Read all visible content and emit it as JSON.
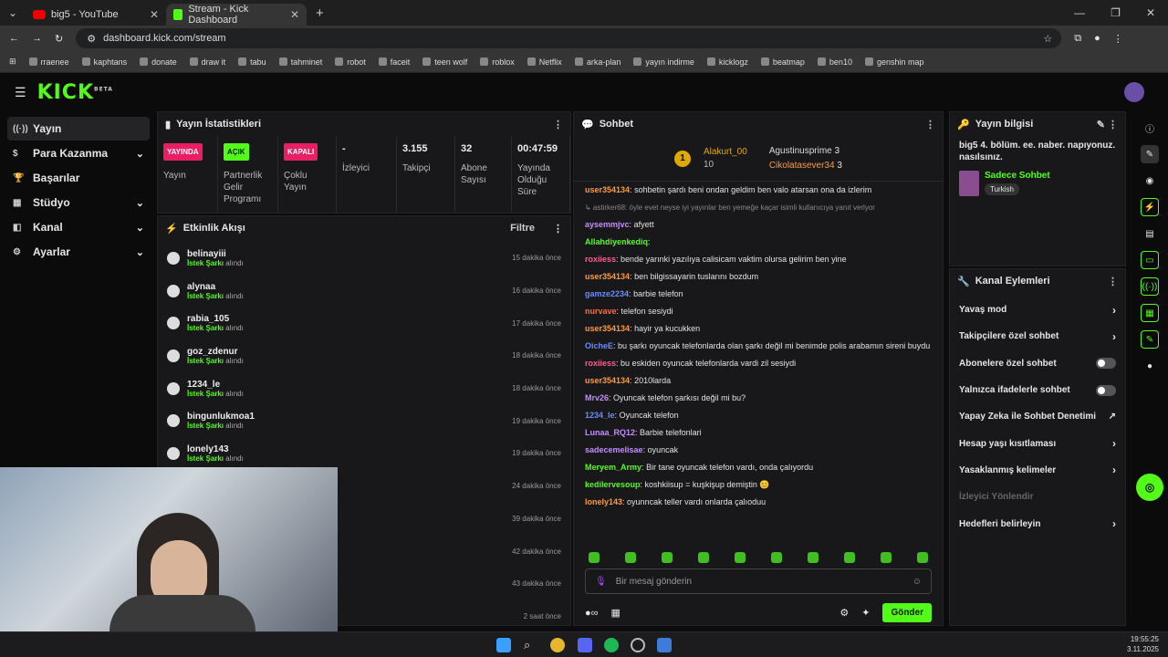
{
  "browser": {
    "tabs": [
      {
        "title": "big5 - YouTube"
      },
      {
        "title": "Stream - Kick Dashboard"
      }
    ],
    "url": "dashboard.kick.com/stream",
    "bookmarks": [
      "rraenee",
      "kaphtans",
      "donate",
      "draw it",
      "tabu",
      "tahminet",
      "robot",
      "faceit",
      "teen wolf",
      "roblox",
      "Netflix",
      "arka-plan",
      "yayın indirme",
      "kicklogz",
      "beatmap",
      "ben10",
      "genshin map"
    ]
  },
  "kick": {
    "logo": "KICK",
    "beta": "BETA"
  },
  "sidebar": [
    {
      "label": "Yayın",
      "chev": false
    },
    {
      "label": "Para Kazanma",
      "chev": true
    },
    {
      "label": "Başarılar",
      "chev": false
    },
    {
      "label": "Stüdyo",
      "chev": true
    },
    {
      "label": "Kanal",
      "chev": true
    },
    {
      "label": "Ayarlar",
      "chev": true
    }
  ],
  "stats": {
    "title": "Yayın İstatistikleri",
    "cells": [
      {
        "badge": "YAYINDA",
        "label": "Yayın"
      },
      {
        "badge": "AÇIK",
        "label": "Partnerlik Gelir Programı"
      },
      {
        "badge": "KAPALI",
        "label": "Çoklu Yayın"
      },
      {
        "value": "-",
        "label": "İzleyici"
      },
      {
        "value": "3.155",
        "label": "Takipçi"
      },
      {
        "value": "32",
        "label": "Abone Sayısı"
      },
      {
        "value": "00:47:59",
        "label": "Yayında Olduğu Süre"
      }
    ]
  },
  "activity": {
    "title": "Etkinlik Akışı",
    "filter": "Filtre",
    "kind": "İstek Şarkı",
    "suffix": "alındı",
    "items": [
      {
        "name": "belinayiii",
        "time": "15 dakika önce"
      },
      {
        "name": "alynaa",
        "time": "16 dakika önce"
      },
      {
        "name": "rabia_105",
        "time": "17 dakika önce"
      },
      {
        "name": "goz_zdenur",
        "time": "18 dakika önce"
      },
      {
        "name": "1234_le",
        "time": "18 dakika önce"
      },
      {
        "name": "bingunlukmoa1",
        "time": "19 dakika önce"
      },
      {
        "name": "lonely143",
        "time": "19 dakika önce"
      },
      {
        "name": "",
        "time": "24 dakika önce"
      },
      {
        "name": "",
        "time": "39 dakika önce"
      },
      {
        "name": "",
        "time": "42 dakika önce"
      },
      {
        "name": "",
        "time": "43 dakika önce"
      },
      {
        "name": "",
        "time": "2 saat önce"
      }
    ]
  },
  "chat": {
    "title": "Sohbet",
    "top": [
      {
        "name": "Alakurt_00",
        "n": "10"
      },
      {
        "name": "Agustinusprime",
        "n": "3"
      },
      {
        "name": "Cikolatasever34",
        "n": "3"
      }
    ],
    "messages": [
      {
        "u": "user354134",
        "c": "#ff9a3c",
        "t": "sohbetin şardı beni ondan geldim ben valo atarsan ona da izlerim"
      },
      {
        "u": "",
        "c": "#888",
        "t": "↳ astirker68: öyle evet neyse iyi yayınlar ben yemeğe kaçar isimli kullanıcıya yanıt verlyor"
      },
      {
        "u": "aysemmjvc",
        "c": "#c58cff",
        "t": "afyett"
      },
      {
        "u": "Allahdiyenkediq",
        "c": "#53fc18",
        "t": ""
      },
      {
        "u": "roxiiess",
        "c": "#ff5d8f",
        "t": "bende yarınki yazılıya calisicam vaktim olursa gelirim ben yine"
      },
      {
        "u": "user354134",
        "c": "#ff9a3c",
        "t": "ben bilgissayarin tuslarını bozdum"
      },
      {
        "u": "gamze2234",
        "c": "#6b8cff",
        "t": "barbie telefon"
      },
      {
        "u": "nurvave",
        "c": "#ff6b3c",
        "t": "telefon sesiydi"
      },
      {
        "u": "user354134",
        "c": "#ff9a3c",
        "t": "hayir ya kucukken"
      },
      {
        "u": "OicheE",
        "c": "#6b8cff",
        "t": "bu şarkı oyuncak telefonlarda olan şarkı değil mi benimde polis arabamın sireni buydu"
      },
      {
        "u": "roxiiess",
        "c": "#ff5d8f",
        "t": "bu eskiden oyuncak telefonlarda vardi zil sesiydi"
      },
      {
        "u": "user354134",
        "c": "#ff9a3c",
        "t": "2010larda"
      },
      {
        "u": "Mrv26",
        "c": "#c58cff",
        "t": "Oyuncak telefon şarkısı değil mi bu?"
      },
      {
        "u": "1234_le",
        "c": "#6b8cff",
        "t": "Oyuncak telefon"
      },
      {
        "u": "Lunaa_RQ12",
        "c": "#c58cff",
        "t": "Barbie telefonlari"
      },
      {
        "u": "sadecemelisae",
        "c": "#c58cff",
        "t": "oyuncak"
      },
      {
        "u": "Meryem_Army",
        "c": "#53fc18",
        "t": "Bir tane oyuncak telefon vardı, onda çalıyordu"
      },
      {
        "u": "kedilervesoup",
        "c": "#53fc18",
        "t": "koshkiisup = kuşkişup demiştin 😊"
      },
      {
        "u": "lonely143",
        "c": "#ff9a3c",
        "t": "oyunncak teller vardı onlarda çalıoduu"
      }
    ],
    "placeholder": "Bir mesaj gönderin",
    "send": "Gönder"
  },
  "info": {
    "title": "Yayın bilgisi",
    "stream_title": "big5 4. bölüm. ee. naber. napıyonuz. nasılsınız.",
    "category": "Sadece Sohbet",
    "tag": "Turkish"
  },
  "actions": {
    "title": "Kanal Eylemleri",
    "items": [
      {
        "label": "Yavaş mod",
        "ctl": "chev"
      },
      {
        "label": "Takipçilere özel sohbet",
        "ctl": "chev"
      },
      {
        "label": "Abonelere özel sohbet",
        "ctl": "toggle"
      },
      {
        "label": "Yalnızca ifadelerle sohbet",
        "ctl": "toggle"
      },
      {
        "label": "Yapay Zeka ile Sohbet Denetimi",
        "ctl": "ext"
      },
      {
        "label": "Hesap yaşı kısıtlaması",
        "ctl": "chev"
      },
      {
        "label": "Yasaklanmış kelimeler",
        "ctl": "chev"
      },
      {
        "label": "İzleyici Yönlendir",
        "ctl": "none",
        "dim": true
      },
      {
        "label": "Hedefleri belirleyin",
        "ctl": "chev"
      }
    ]
  },
  "clock": {
    "time": "19:55:25",
    "date": "3.11.2025"
  }
}
